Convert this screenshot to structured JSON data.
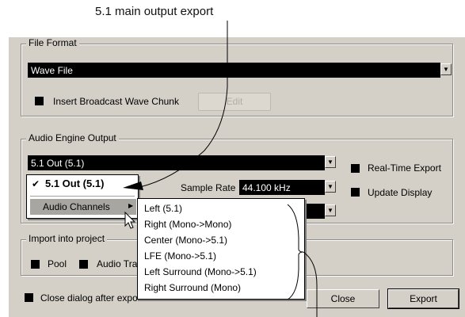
{
  "caption": "5.1 main output export",
  "file_format": {
    "legend": "File Format",
    "selected": "Wave File",
    "broadcast_label": "Insert Broadcast Wave Chunk",
    "edit_label": "Edit"
  },
  "audio_engine": {
    "legend": "Audio Engine Output",
    "selected": "5.1 Out (5.1)",
    "sample_rate_label": "Sample Rate",
    "sample_rate_value": "44.100 kHz",
    "realtime_label": "Real-Time Export",
    "update_label": "Update Display"
  },
  "popup": {
    "checked_item": "5.1 Out (5.1)",
    "check_mark": "✔",
    "audio_channels": "Audio Channels",
    "submenu_arrow": "▶"
  },
  "submenu": [
    "Left (5.1)",
    "Right (Mono->Mono)",
    "Center (Mono->5.1)",
    "LFE (Mono->5.1)",
    "Left Surround (Mono->5.1)",
    "Right Surround (Mono)"
  ],
  "import": {
    "legend": "Import into project",
    "pool_label": "Pool",
    "audio_track_label": "Audio Tra"
  },
  "close_after_label": "Close dialog after expor",
  "buttons": {
    "close": "Close",
    "export": "Export"
  },
  "icons": {
    "dropdown": "▼"
  }
}
